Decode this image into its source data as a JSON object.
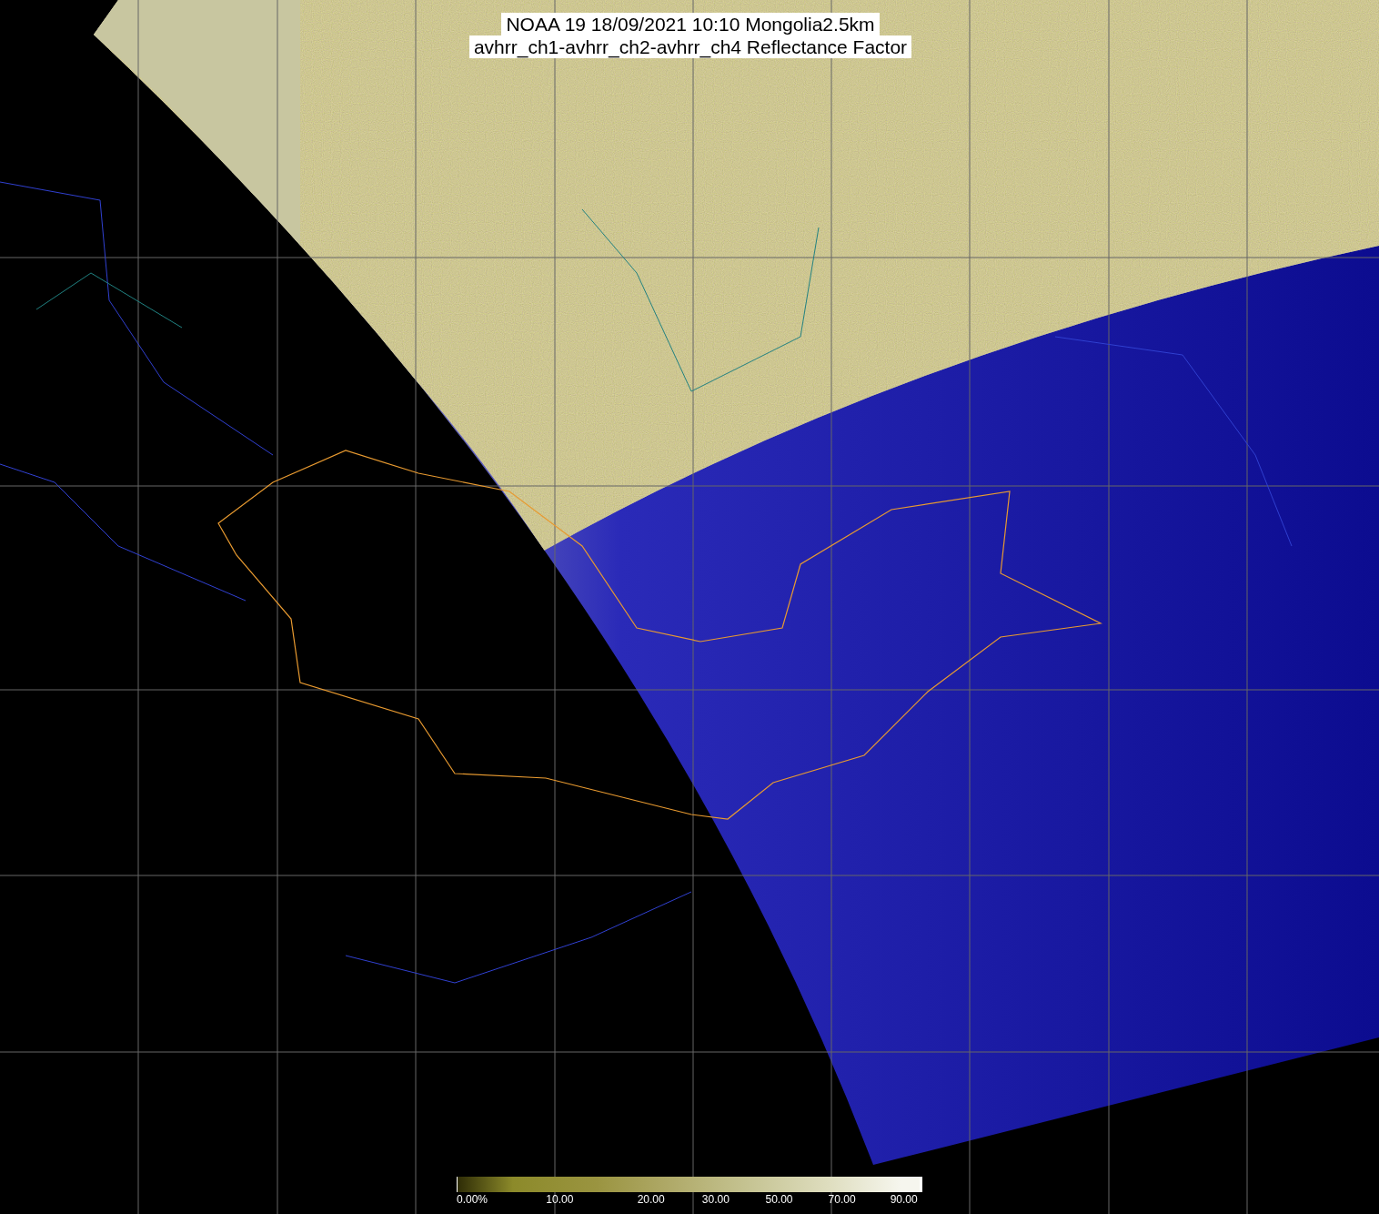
{
  "title": {
    "lines": [
      "NOAA 19 18/09/2021 10:10 Mongolia2.5km",
      "avhrr_ch1-avhrr_ch2-avhrr_ch4 Reflectance Factor"
    ]
  },
  "colorbar": {
    "labels": [
      "0.00%",
      "10.00",
      "20.00",
      "30.00",
      "50.00",
      "70.00",
      "90.00"
    ]
  }
}
